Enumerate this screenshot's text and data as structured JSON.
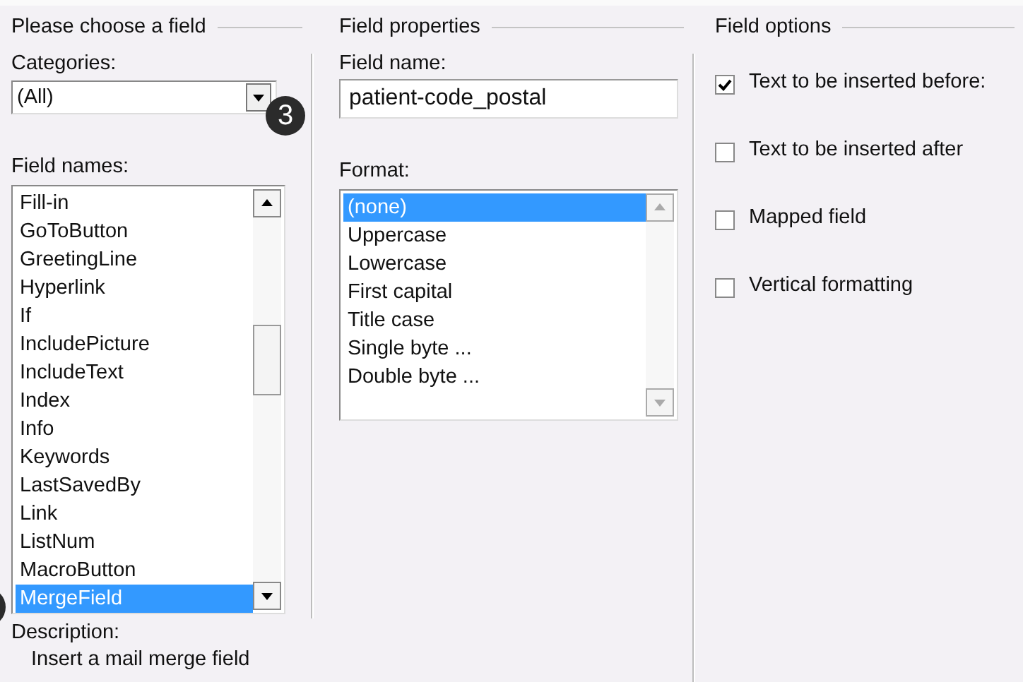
{
  "choose": {
    "title": "Please choose a field",
    "categories_label": "Categories:",
    "category": "(All)",
    "field_names_label": "Field names:",
    "field_names": [
      {
        "label": "Fill-in",
        "selected": false
      },
      {
        "label": "GoToButton",
        "selected": false
      },
      {
        "label": "GreetingLine",
        "selected": false
      },
      {
        "label": "Hyperlink",
        "selected": false
      },
      {
        "label": "If",
        "selected": false
      },
      {
        "label": "IncludePicture",
        "selected": false
      },
      {
        "label": "IncludeText",
        "selected": false
      },
      {
        "label": "Index",
        "selected": false
      },
      {
        "label": "Info",
        "selected": false
      },
      {
        "label": "Keywords",
        "selected": false
      },
      {
        "label": "LastSavedBy",
        "selected": false
      },
      {
        "label": "Link",
        "selected": false
      },
      {
        "label": "ListNum",
        "selected": false
      },
      {
        "label": "MacroButton",
        "selected": false
      },
      {
        "label": "MergeField",
        "selected": true
      }
    ],
    "description_label": "Description:",
    "description": "Insert a mail merge field"
  },
  "properties": {
    "title": "Field properties",
    "field_name_label": "Field name:",
    "field_name": "patient-code_postal",
    "format_label": "Format:",
    "formats": [
      {
        "label": "(none)",
        "selected": true
      },
      {
        "label": "Uppercase",
        "selected": false
      },
      {
        "label": "Lowercase",
        "selected": false
      },
      {
        "label": "First capital",
        "selected": false
      },
      {
        "label": "Title case",
        "selected": false
      },
      {
        "label": "Single byte ...",
        "selected": false
      },
      {
        "label": "Double byte ...",
        "selected": false
      }
    ]
  },
  "options": {
    "title": "Field options",
    "checkboxes": [
      {
        "label": "Text to be inserted before:",
        "checked": true
      },
      {
        "label": "Text to be inserted after",
        "checked": false
      },
      {
        "label": "Mapped field",
        "checked": false
      },
      {
        "label": "Vertical formatting",
        "checked": false
      }
    ]
  },
  "callout": {
    "label": "3"
  }
}
